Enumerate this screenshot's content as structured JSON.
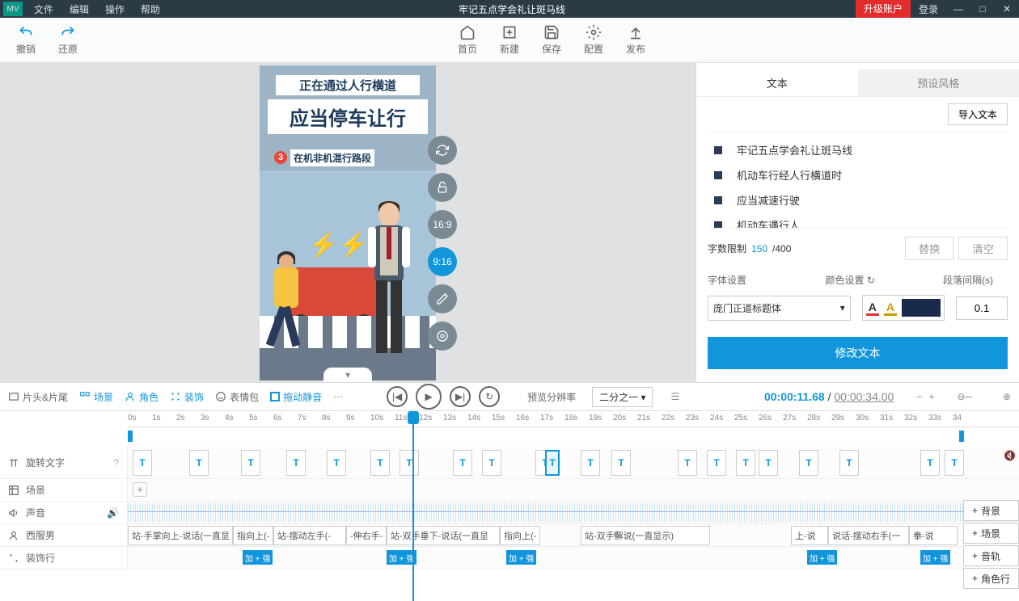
{
  "titlebar": {
    "logo": "MV",
    "menus": [
      "文件",
      "编辑",
      "操作",
      "帮助"
    ],
    "title": "牢记五点学会礼让斑马线",
    "upgrade": "升级账户",
    "login": "登录"
  },
  "toolbar": {
    "undo": "撤销",
    "redo": "还原",
    "home": "首页",
    "new": "新建",
    "save": "保存",
    "config": "配置",
    "publish": "发布"
  },
  "stage": {
    "line1": "正在通过人行横道",
    "line2": "应当停车让行",
    "badge": "3",
    "line3": "在机非机混行路段"
  },
  "canvasTools": {
    "ratio1": "16:9",
    "ratio2": "9:16"
  },
  "rightPanel": {
    "tabs": [
      "文本",
      "预设风格"
    ],
    "import": "导入文本",
    "items": [
      "牢记五点学会礼让斑马线",
      "机动车行经人行横道时",
      "应当减速行驶",
      "机动车遇行人"
    ],
    "limit": {
      "label": "字数限制",
      "count": "150",
      "total": "/400",
      "replace": "替换",
      "clear": "清空"
    },
    "settings": {
      "font": "字体设置",
      "color": "颜色设置",
      "gap": "段落间隔(s)"
    },
    "fontName": "庞门正道标题体",
    "gapVal": "0.1",
    "apply": "修改文本"
  },
  "midbar": {
    "btns": {
      "headtail": "片头&片尾",
      "scene": "场景",
      "role": "角色",
      "deco": "装饰",
      "emoji": "表情包",
      "mute": "拖动静音"
    },
    "preview": {
      "label": "预览分辨率",
      "value": "二分之一"
    },
    "time": {
      "cur": "00:00:11.68",
      "sep": " / ",
      "tot": "00:00:34.00"
    }
  },
  "timeline": {
    "ticks": [
      "0s",
      "1s",
      "2s",
      "3s",
      "4s",
      "5s",
      "6s",
      "7s",
      "8s",
      "9s",
      "10s",
      "11s",
      "12s",
      "13s",
      "14s",
      "15s",
      "16s",
      "17s",
      "18s",
      "19s",
      "20s",
      "21s",
      "22s",
      "23s",
      "24s",
      "25s",
      "26s",
      "27s",
      "28s",
      "29s",
      "30s",
      "31s",
      "32s",
      "33s",
      "34"
    ],
    "tracks": {
      "text": "旋转文字",
      "scene": "场景",
      "sound": "声音",
      "man": "西服男",
      "deco": "装饰行"
    },
    "clips": {
      "actions": [
        "站-手掌向上-说话(一直显",
        "指向上(-",
        "站-摆动左手(-",
        "-伸右手-",
        "站-双手垂下-说话(一直显",
        "指向上(-",
        "站-双手解说(一直显示)",
        "上-说",
        "说话-摆动右手(一",
        "拳-说"
      ],
      "deco": "加 + 强"
    },
    "sideBtns": [
      "背景",
      "场景",
      "音轨",
      "角色行"
    ]
  }
}
